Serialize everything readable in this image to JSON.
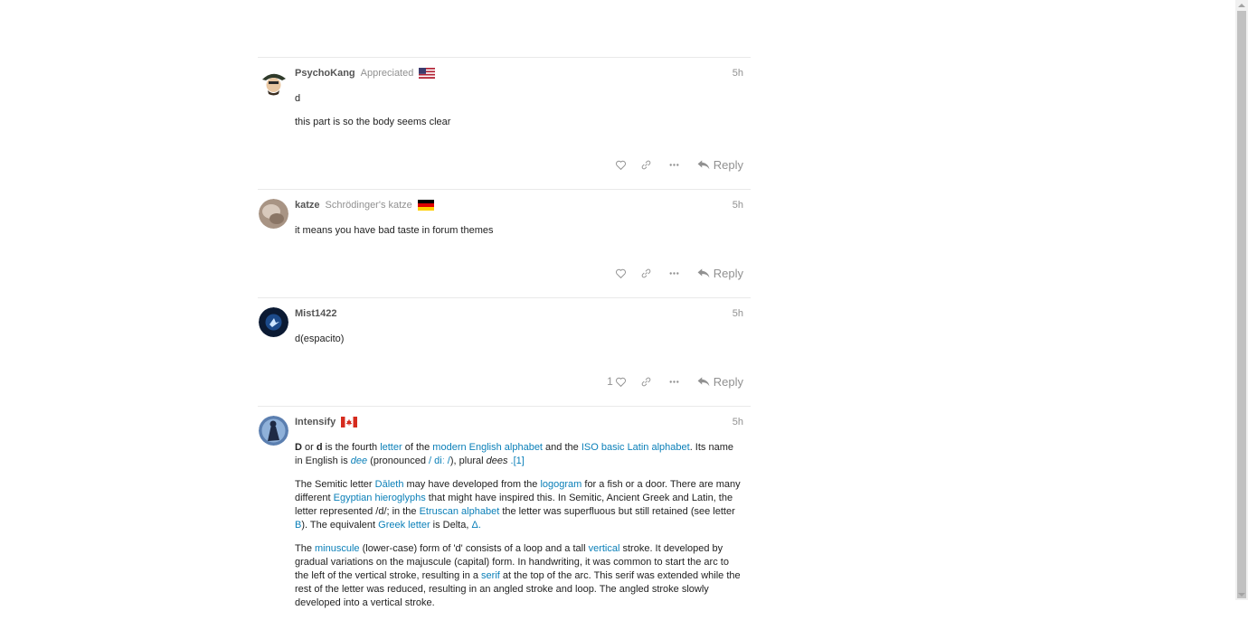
{
  "posts": [
    {
      "username": "PsychoKang",
      "user_title": "Appreciated",
      "flag": "us-flag",
      "date": "5h",
      "paragraphs": [
        "d",
        "this part is so the body seems clear"
      ],
      "like_count": "",
      "reply_label": "Reply"
    },
    {
      "username": "katze",
      "user_title": "Schrödinger's katze",
      "flag": "de-flag",
      "date": "5h",
      "paragraphs": [
        "it means you have bad taste in forum themes"
      ],
      "like_count": "",
      "reply_label": "Reply"
    },
    {
      "username": "Mist1422",
      "user_title": "",
      "flag": "",
      "date": "5h",
      "paragraphs": [
        "d(espacito)"
      ],
      "like_count": "1",
      "reply_label": "Reply"
    },
    {
      "username": "Intensify",
      "user_title": "",
      "flag": "ca-flag",
      "date": "5h",
      "rich": {
        "p1": {
          "b1": "D",
          "t1": " or ",
          "b2": "d",
          "t2": " is the fourth ",
          "l1": "letter",
          "t3": " of the ",
          "l2": "modern English alphabet",
          "t4": " and the ",
          "l3": "ISO basic Latin alphabet",
          "t5": ". Its name in English is ",
          "l4": "dee",
          "t6": " (pronounced ",
          "l5": "/ diː /",
          "t7": "), plural ",
          "i1": "dees",
          "t8": " ",
          "l6": ".[1]"
        },
        "p2": {
          "t1": "The Semitic letter ",
          "l1": "Dāleth",
          "t2": " may have developed from the ",
          "l2": "logogram",
          "t3": " for a fish or a door. There are many different ",
          "l3": "Egyptian hieroglyphs",
          "t4": " that might have inspired this. In Semitic, Ancient Greek and Latin, the letter represented /d/; in the ",
          "l4": "Etruscan alphabet",
          "t5": " the letter was superfluous but still retained (see letter ",
          "l5": "B",
          "t6": "). The equivalent ",
          "l6": "Greek letter",
          "t7": " is Delta, ",
          "l7": "Δ."
        },
        "p3": {
          "t1": "The ",
          "l1": "minuscule",
          "t2": " (lower-case) form of 'd' consists of a loop and a tall ",
          "l2": "vertical",
          "t3": " stroke. It developed by gradual variations on the majuscule (capital) form. In handwriting, it was common to start the arc to the left of the vertical stroke, resulting in a ",
          "l3": "serif",
          "t4": " at the top of the arc. This serif was extended while the rest of the letter was reduced, resulting in an angled stroke and loop. The angled stroke slowly developed into a vertical stroke."
        }
      }
    }
  ],
  "colors": {
    "link": "#0a7fb8",
    "muted": "#919191",
    "divider": "#e9e9e9"
  },
  "icons": [
    "heart-icon",
    "link-icon",
    "ellipsis-icon",
    "reply-icon"
  ]
}
